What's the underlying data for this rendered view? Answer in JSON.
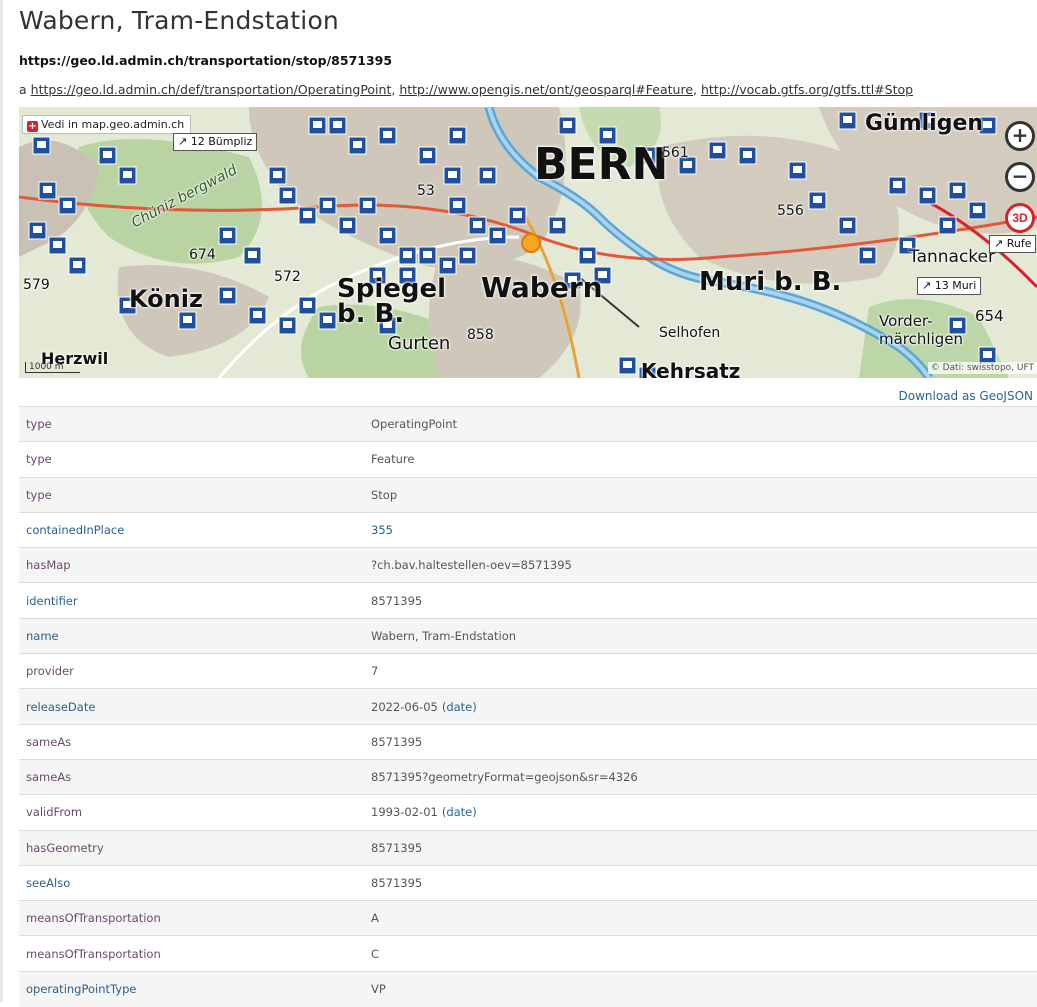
{
  "page": {
    "title": "Wabern, Tram-Endstation",
    "uri": "https://geo.ld.admin.ch/transportation/stop/8571395",
    "types_prefix": "a",
    "types": [
      "https://geo.ld.admin.ch/def/transportation/OperatingPoint",
      "http://www.opengis.net/ont/geosparql#Feature",
      "http://vocab.gtfs.org/gtfs.ttl#Stop"
    ],
    "types_sep": ", "
  },
  "map": {
    "link_label": "Vedi in map.geo.admin.ch",
    "direction_labels": [
      "12 Bümpliz",
      "13 Muri",
      "Rufe"
    ],
    "places": [
      "BERN",
      "Gümligen",
      "Köniz",
      "Spiegel b. B.",
      "Wabern",
      "Muri b. B.",
      "Gurten",
      "Tannacker",
      "Vorder-märchligen",
      "Kehrsatz",
      "Herzwil",
      "Selhofen",
      "Chüniz bergwald"
    ],
    "numbers": [
      "561",
      "674",
      "572",
      "579",
      "858",
      "556",
      "654",
      "53"
    ],
    "scale": "1000 m",
    "copyright": "© Dati: swisstopo, UFT",
    "zoom_in": "+",
    "zoom_out": "−",
    "btn_3d": "3D",
    "colors": {
      "stop_icon": "#1f4fa0",
      "marker": "#f5a623",
      "route": "#d8232a"
    }
  },
  "download_label": "Download as GeoJSON",
  "rows": [
    {
      "key": "type",
      "value": "OperatingPoint",
      "style": "purple"
    },
    {
      "key": "type",
      "value": "Feature",
      "style": "purple"
    },
    {
      "key": "type",
      "value": "Stop",
      "style": "purple"
    },
    {
      "key": "containedInPlace",
      "value": "355",
      "style": "blue",
      "value_blue": true
    },
    {
      "key": "hasMap",
      "value": "?ch.bav.haltestellen-oev=8571395",
      "style": "purple"
    },
    {
      "key": "identifier",
      "value": "8571395",
      "style": "blue"
    },
    {
      "key": "name",
      "value": "Wabern, Tram-Endstation",
      "style": "blue"
    },
    {
      "key": "provider",
      "value": "7",
      "style": "purple"
    },
    {
      "key": "releaseDate",
      "value": "2022-06-05",
      "dtype": "(date)",
      "style": "blue"
    },
    {
      "key": "sameAs",
      "value": "8571395",
      "style": "purple"
    },
    {
      "key": "sameAs",
      "value": "8571395?geometryFormat=geojson&sr=4326",
      "style": "purple"
    },
    {
      "key": "validFrom",
      "value": "1993-02-01",
      "dtype": "(date)",
      "style": "purple"
    },
    {
      "key": "hasGeometry",
      "value": "8571395",
      "style": "purple"
    },
    {
      "key": "seeAlso",
      "value": "8571395",
      "style": "blue"
    },
    {
      "key": "meansOfTransportation",
      "value": "A",
      "style": "purple"
    },
    {
      "key": "meansOfTransportation",
      "value": "C",
      "style": "purple"
    },
    {
      "key": "operatingPointType",
      "value": "VP",
      "style": "blue"
    }
  ]
}
